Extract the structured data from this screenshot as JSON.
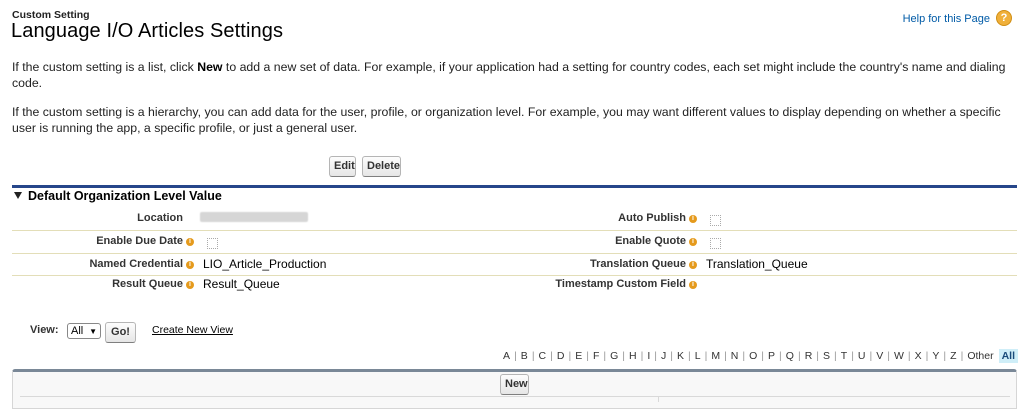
{
  "header": {
    "setting_type": "Custom Setting",
    "title": "Language I/O Articles Settings",
    "help_link": "Help for this Page",
    "help_icon": "?"
  },
  "description": {
    "list_prefix": "If the custom setting is a list, click ",
    "list_bold": "New",
    "list_suffix": " to add a new set of data. For example, if your application had a setting for country codes, each set might include the country's name and dialing code.",
    "hierarchy": "If the custom setting is a hierarchy, you can add data for the user, profile, or organization level. For example, you may want different values to display depending on whether a specific user is running the app, a specific profile, or just a general user."
  },
  "buttons": {
    "edit": "Edit",
    "delete": "Delete",
    "new": "New",
    "go": "Go!"
  },
  "section": {
    "title": "Default Organization Level Value",
    "fields": {
      "location": {
        "label": "Location",
        "value": ""
      },
      "auto_publish": {
        "label": "Auto Publish",
        "checked": false
      },
      "enable_due_date": {
        "label": "Enable Due Date",
        "checked": false
      },
      "enable_quote": {
        "label": "Enable Quote",
        "checked": false
      },
      "named_credential": {
        "label": "Named Credential",
        "value": "LIO_Article_Production"
      },
      "translation_queue": {
        "label": "Translation Queue",
        "value": "Translation_Queue"
      },
      "result_queue": {
        "label": "Result Queue",
        "value": "Result_Queue"
      },
      "timestamp_custom_field": {
        "label": "Timestamp Custom Field",
        "value": ""
      }
    }
  },
  "list_view": {
    "label": "View:",
    "selected": "All",
    "create_link": "Create New View",
    "alphabet": [
      "A",
      "B",
      "C",
      "D",
      "E",
      "F",
      "G",
      "H",
      "I",
      "J",
      "K",
      "L",
      "M",
      "N",
      "O",
      "P",
      "Q",
      "R",
      "S",
      "T",
      "U",
      "V",
      "W",
      "X",
      "Y",
      "Z",
      "Other"
    ],
    "all_label": "All"
  },
  "colors": {
    "section_bar": "#26468a",
    "link": "#015ba7",
    "help_icon": "#f0b03a"
  }
}
